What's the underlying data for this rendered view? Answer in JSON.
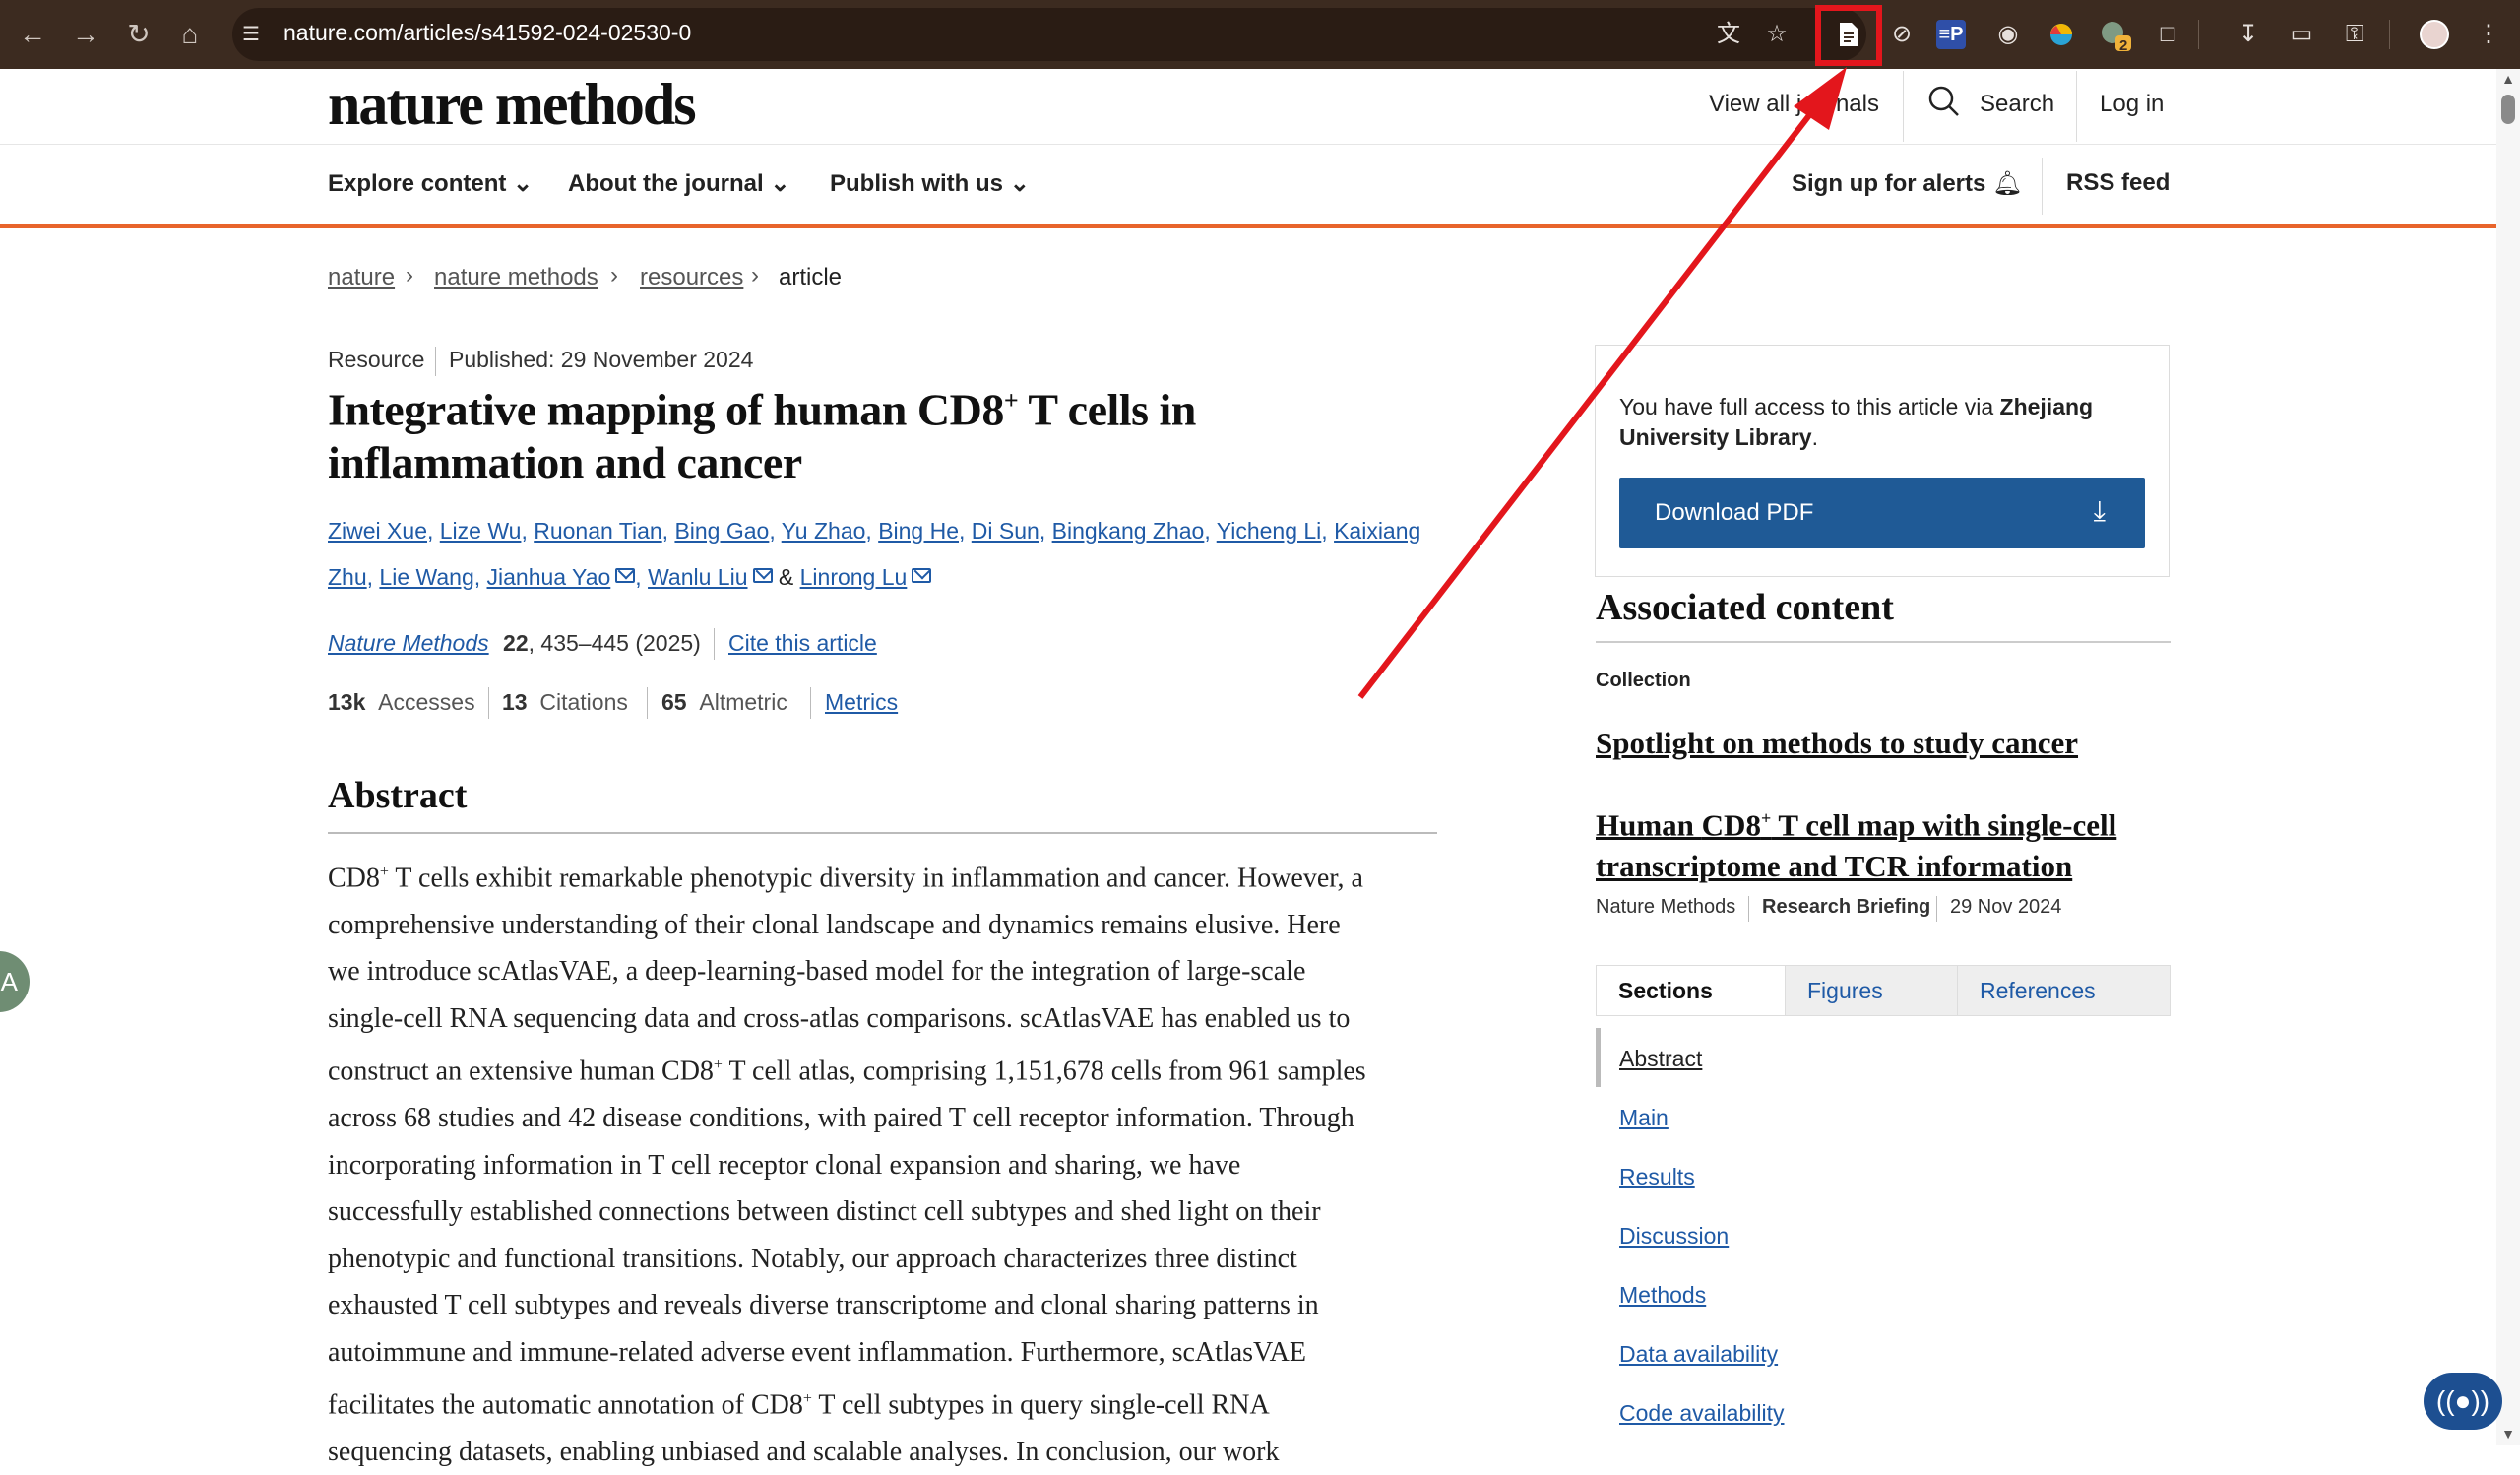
{
  "browser": {
    "url": "nature.com/articles/s41592-024-02530-0",
    "nav_icons": [
      "back-icon",
      "forward-icon",
      "reload-icon",
      "home-icon"
    ],
    "extensions": [
      "translate-icon",
      "star-icon",
      "reader-mode-icon",
      "blocker-icon",
      "ep-extension-icon",
      "glasses-extension-icon",
      "color-extension-icon",
      "badge-extension-icon",
      "puzzle-icon",
      "download-icon",
      "card-icon",
      "key-icon",
      "profile-avatar",
      "kebab-menu-icon"
    ],
    "ep_label": "≡P",
    "badge_count": "2",
    "highlight_color": "#e3161c"
  },
  "header": {
    "logo": "nature methods",
    "view_journals": "View all journals",
    "search": "Search",
    "login": "Log in"
  },
  "nav": {
    "explore": "Explore content",
    "about": "About the journal",
    "publish": "Publish with us",
    "alerts": "Sign up for alerts",
    "rss": "RSS feed"
  },
  "breadcrumb": [
    "nature",
    "nature methods",
    "resources",
    "article"
  ],
  "article": {
    "type": "Resource",
    "published": "Published: 29 November 2024",
    "title_part1": "Integrative mapping of human CD8",
    "title_sup": "+",
    "title_part2": " T cells in inflammation and cancer",
    "authors_line1": [
      "Ziwei Xue",
      "Lize Wu",
      "Ruonan Tian",
      "Bing Gao",
      "Yu Zhao",
      "Bing He",
      "Di Sun",
      "Bingkang Zhao",
      "Yicheng Li",
      "Kaixiang"
    ],
    "authors_line2": [
      "Zhu",
      "Lie Wang",
      "Jianhua Yao",
      "Wanlu Liu",
      "Linrong Lu"
    ],
    "amp": "&",
    "journal": "Nature Methods",
    "volume": "22",
    "pages_year": ", 435–445 (2025)",
    "cite": "Cite this article",
    "accesses_value": "13k",
    "accesses_label": "Accesses",
    "citations_value": "13",
    "citations_label": "Citations",
    "altmetric_value": "65",
    "altmetric_label": "Altmetric",
    "metrics": "Metrics",
    "abstract_heading": "Abstract",
    "abstract_lines": [
      "CD8+ T cells exhibit remarkable phenotypic diversity in inflammation and cancer. However, a",
      "comprehensive understanding of their clonal landscape and dynamics remains elusive. Here",
      "we introduce scAtlasVAE, a deep-learning-based model for the integration of large-scale",
      "single-cell RNA sequencing data and cross-atlas comparisons. scAtlasVAE has enabled us to",
      "construct an extensive human CD8+ T cell atlas, comprising 1,151,678 cells from 961 samples",
      "across 68 studies and 42 disease conditions, with paired T cell receptor information. Through",
      "incorporating information in T cell receptor clonal expansion and sharing, we have",
      "successfully established connections between distinct cell subtypes and shed light on their",
      "phenotypic and functional transitions. Notably, our approach characterizes three distinct",
      "exhausted T cell subtypes and reveals diverse transcriptome and clonal sharing patterns in",
      "autoimmune and immune-related adverse event inflammation. Furthermore, scAtlasVAE",
      "facilitates the automatic annotation of CD8+ T cell subtypes in query single-cell RNA",
      "sequencing datasets, enabling unbiased and scalable analyses. In conclusion, our work"
    ]
  },
  "sidebar": {
    "access_prefix": "You have full access to this article via ",
    "access_institution": "Zhejiang University Library",
    "access_suffix": ".",
    "download_pdf": "Download PDF",
    "assoc_heading": "Associated content",
    "collection_label": "Collection",
    "spotlight": "Spotlight on methods to study cancer",
    "briefing_title": "Human CD8+ T cell map with single-cell transcriptome and TCR information",
    "briefing_journal": "Nature Methods",
    "briefing_type": "Research Briefing",
    "briefing_date": "29 Nov 2024",
    "tabs": [
      "Sections",
      "Figures",
      "References"
    ],
    "toc": [
      "Abstract",
      "Main",
      "Results",
      "Discussion",
      "Methods",
      "Data availability",
      "Code availability"
    ]
  },
  "colors": {
    "accent_orange": "#e8642b",
    "link_blue": "#1f5aa6",
    "button_blue": "#1f5a96",
    "annotation_red": "#e3161c"
  }
}
